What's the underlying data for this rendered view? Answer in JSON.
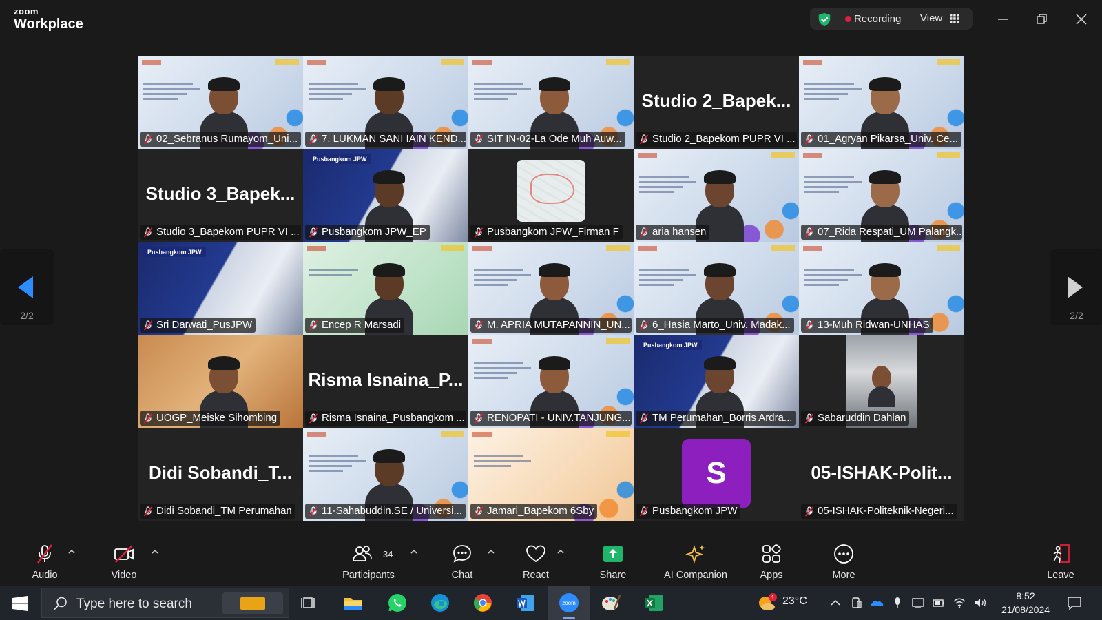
{
  "app": {
    "brand_top": "zoom",
    "brand_bottom": "Workplace"
  },
  "status": {
    "recording_label": "Recording",
    "view_label": "View",
    "accent_green": "#1fb56b",
    "record_red": "#e0213b"
  },
  "pagination": {
    "left_page": "2/2",
    "right_page": "2/2"
  },
  "tiles": [
    {
      "name": "02_Sebranus Rumayom_Uni...",
      "kind": "slide-person"
    },
    {
      "name": "7. LUKMAN SANI IAIN KEND...",
      "kind": "slide-person"
    },
    {
      "name": "SIT IN-02-La Ode Muh Auw...",
      "kind": "slide-person"
    },
    {
      "name": "Studio 2_Bapekom PUPR VI ...",
      "kind": "name-only",
      "big": "Studio  2_Bapek..."
    },
    {
      "name": "01_Agryan Pikarsa_Univ. Ce...",
      "kind": "slide-person"
    },
    {
      "name": "Studio 3_Bapekom PUPR VI ...",
      "kind": "name-only",
      "big": "Studio  3_Bapek..."
    },
    {
      "name": "Pusbangkom JPW_EP",
      "kind": "bldg-person",
      "banner": "Pusbangkom JPW"
    },
    {
      "name": "Pusbangkom JPW_Firman F",
      "kind": "map"
    },
    {
      "name": "aria hansen",
      "kind": "slide-person"
    },
    {
      "name": "07_Rida Respati_UM Palangk...",
      "kind": "slide-person"
    },
    {
      "name": "Sri Darwati_PusJPW",
      "kind": "bldg",
      "banner": "Pusbangkom JPW"
    },
    {
      "name": "Encep R Marsadi",
      "kind": "green-person"
    },
    {
      "name": "M. APRIA MUTAPANNIN_UN...",
      "kind": "slide-person"
    },
    {
      "name": "6_Hasia Marto_Univ. Madak...",
      "kind": "slide-person"
    },
    {
      "name": "13-Muh Ridwan-UNHAS",
      "kind": "slide-person"
    },
    {
      "name": "UOGP_Meiske Sihombing",
      "kind": "wood-person"
    },
    {
      "name": "Risma Isnaina_Pusbangkom ...",
      "kind": "name-only",
      "big": "Risma  Isnaina_P..."
    },
    {
      "name": "RENOPATI - UNIV.TANJUNG...",
      "kind": "slide-person"
    },
    {
      "name": "TM Perumahan_Borris Ardra...",
      "kind": "bldg-person",
      "banner": "Pusbangkom JPW"
    },
    {
      "name": "Sabaruddin Dahlan",
      "kind": "car"
    },
    {
      "name": "Didi Sobandi_TM Perumahan",
      "kind": "name-only",
      "big": "Didi  Sobandi_T..."
    },
    {
      "name": "11-Sahabuddin.SE / Universi...",
      "kind": "slide-person"
    },
    {
      "name": "Jamari_Bapekom 6Sby",
      "kind": "warm"
    },
    {
      "name": "Pusbangkom JPW",
      "kind": "avatar",
      "initial": "S"
    },
    {
      "name": "05-ISHAK-Politeknik-Negeri...",
      "kind": "name-only",
      "big": "05-ISHAK-Polit..."
    }
  ],
  "toolbar": {
    "audio": "Audio",
    "video": "Video",
    "participants": "Participants",
    "participants_count": "34",
    "chat": "Chat",
    "react": "React",
    "share": "Share",
    "ai_companion": "AI Companion",
    "apps": "Apps",
    "more": "More",
    "leave": "Leave"
  },
  "taskbar": {
    "search_placeholder": "Type here to search",
    "temperature": "23°C",
    "weather_badge": "1",
    "time": "8:52",
    "date": "21/08/2024"
  }
}
